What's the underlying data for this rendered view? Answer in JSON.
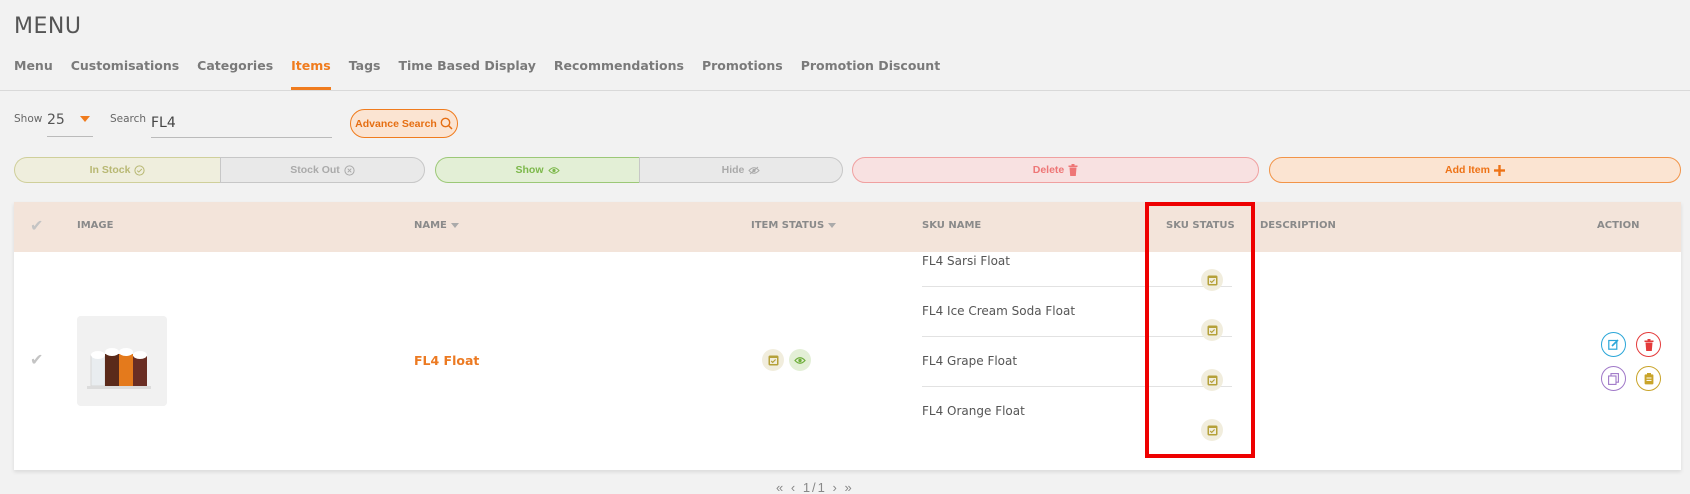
{
  "page": {
    "title": "MENU"
  },
  "tabs": [
    {
      "label": "Menu",
      "active": false
    },
    {
      "label": "Customisations",
      "active": false
    },
    {
      "label": "Categories",
      "active": false
    },
    {
      "label": "Items",
      "active": true
    },
    {
      "label": "Tags",
      "active": false
    },
    {
      "label": "Time Based Display",
      "active": false
    },
    {
      "label": "Recommendations",
      "active": false
    },
    {
      "label": "Promotions",
      "active": false
    },
    {
      "label": "Promotion Discount",
      "active": false
    }
  ],
  "filters": {
    "show_label": "Show",
    "show_value": "25",
    "search_label": "Search",
    "search_value": "FL4",
    "advance_search_label": "Advance Search"
  },
  "actions": {
    "in_stock": "In Stock",
    "stock_out": "Stock Out",
    "show": "Show",
    "hide": "Hide",
    "delete": "Delete",
    "add_item": "Add Item"
  },
  "table": {
    "headers": {
      "image": "IMAGE",
      "name": "NAME",
      "item_status": "ITEM STATUS",
      "sku_name": "SKU NAME",
      "sku_status": "SKU STATUS",
      "description": "DESCRIPTION",
      "action": "ACTION"
    },
    "rows": [
      {
        "name": "FL4 Float",
        "description": "",
        "skus": [
          {
            "name": "FL4 Sarsi Float",
            "status": "in-stock"
          },
          {
            "name": "FL4 Ice Cream Soda Float",
            "status": "in-stock"
          },
          {
            "name": "FL4 Grape Float",
            "status": "in-stock"
          },
          {
            "name": "FL4 Orange Float",
            "status": "in-stock"
          }
        ]
      }
    ]
  },
  "pagination": {
    "label": "1/1"
  },
  "colors": {
    "accent": "#f07c1e",
    "highlight": "#ee0000",
    "header_bg": "#f3e4da"
  }
}
